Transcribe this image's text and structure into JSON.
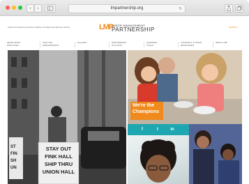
{
  "browser": {
    "url": "lmpartnership.org",
    "back_icon": "chevron-left-icon",
    "forward_icon": "chevron-right-icon",
    "sidebar_icon": "sidebar-icon",
    "reload_icon": "reload-icon",
    "share_icon": "share-icon",
    "tabs_icon": "tabs-icon",
    "back_glyph": "‹",
    "forward_glyph": "›",
    "reload_glyph": "↻"
  },
  "header": {
    "tagline": "Kaiser Permanente and the Coalition of Kaiser Permanente Unions",
    "logo_mark": "LMP",
    "logo_small": "LABOR MANAGEMENT",
    "logo_big": "PARTNERSHIP",
    "search_label": "SEARCH"
  },
  "nav": {
    "items": [
      {
        "line1": "Developing",
        "line2": "Practices"
      },
      {
        "line1": "Tips for",
        "line2": "Performance"
      },
      {
        "line1": "Gallery",
        "line2": ""
      },
      {
        "line1": "Partnership",
        "line2": "in Action"
      },
      {
        "line1": "Learning",
        "line2": "Tools"
      },
      {
        "line1": "Contract & Union",
        "line2": "Resources"
      },
      {
        "line1": "About LMP",
        "line2": ""
      }
    ]
  },
  "hero": {
    "champions_line1": "We're the",
    "champions_line2": "Champions",
    "sign_text": "STAY OUT FINK HALL SHIP THRU UNION HALL",
    "social": [
      {
        "icon": "facebook-icon",
        "glyph": "f"
      },
      {
        "icon": "twitter-icon",
        "glyph": "t"
      },
      {
        "icon": "linkedin-icon",
        "glyph": "in"
      }
    ]
  },
  "colors": {
    "brand_orange": "#f08a1c",
    "social_teal": "#1ea7b0"
  }
}
